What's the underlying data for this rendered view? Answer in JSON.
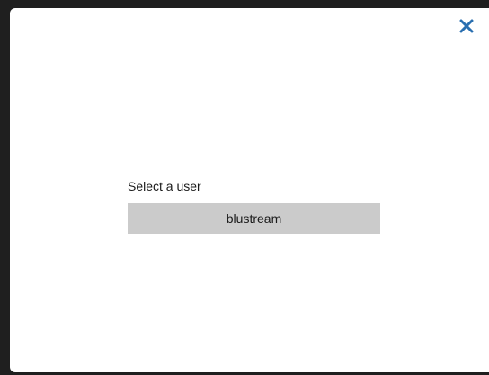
{
  "dialog": {
    "close_icon": "close-icon",
    "close_color": "#2a6fb0",
    "prompt": "Select a user",
    "users": [
      {
        "name": "blustream"
      }
    ]
  }
}
